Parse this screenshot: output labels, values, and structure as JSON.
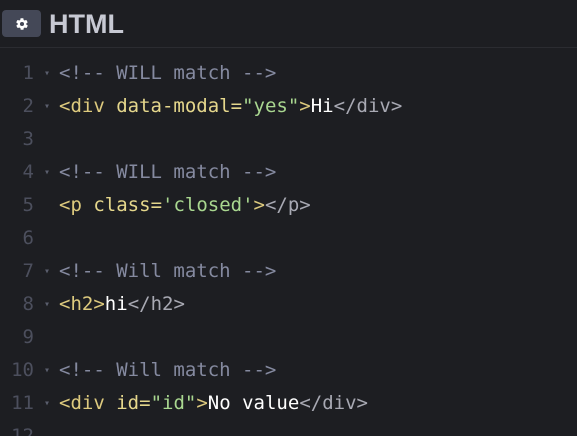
{
  "header": {
    "title": "HTML",
    "settings_icon": "gear-icon"
  },
  "lines": [
    {
      "num": "1",
      "fold": true,
      "tokens": [
        [
          "comment",
          "<!-- WILL match -->"
        ]
      ]
    },
    {
      "num": "2",
      "fold": true,
      "tokens": [
        [
          "bracket",
          "<"
        ],
        [
          "tag",
          "div"
        ],
        [
          "text",
          " "
        ],
        [
          "attr",
          "data-modal"
        ],
        [
          "eq",
          "="
        ],
        [
          "str",
          "\"yes\""
        ],
        [
          "bracket",
          ">"
        ],
        [
          "text",
          "Hi"
        ],
        [
          "dim",
          "</div>"
        ]
      ]
    },
    {
      "num": "3",
      "fold": false,
      "tokens": []
    },
    {
      "num": "4",
      "fold": true,
      "tokens": [
        [
          "comment",
          "<!-- WILL match -->"
        ]
      ]
    },
    {
      "num": "5",
      "fold": false,
      "tokens": [
        [
          "bracket",
          "<"
        ],
        [
          "tag",
          "p"
        ],
        [
          "text",
          " "
        ],
        [
          "attr",
          "class"
        ],
        [
          "eq",
          "="
        ],
        [
          "str",
          "'closed'"
        ],
        [
          "bracket",
          ">"
        ],
        [
          "dim",
          "</p>"
        ]
      ]
    },
    {
      "num": "6",
      "fold": false,
      "tokens": []
    },
    {
      "num": "7",
      "fold": true,
      "tokens": [
        [
          "comment",
          "<!-- Will match -->"
        ]
      ]
    },
    {
      "num": "8",
      "fold": true,
      "tokens": [
        [
          "bracket",
          "<"
        ],
        [
          "tag",
          "h2"
        ],
        [
          "bracket",
          ">"
        ],
        [
          "text",
          "hi"
        ],
        [
          "dim",
          "</h2>"
        ]
      ]
    },
    {
      "num": "9",
      "fold": false,
      "tokens": []
    },
    {
      "num": "10",
      "fold": true,
      "tokens": [
        [
          "comment",
          "<!-- Will match -->"
        ]
      ]
    },
    {
      "num": "11",
      "fold": true,
      "tokens": [
        [
          "bracket",
          "<"
        ],
        [
          "tag",
          "div"
        ],
        [
          "text",
          " "
        ],
        [
          "attr",
          "id"
        ],
        [
          "eq",
          "="
        ],
        [
          "str",
          "\"id\""
        ],
        [
          "bracket",
          ">"
        ],
        [
          "text",
          "No value"
        ],
        [
          "dim",
          "</div>"
        ]
      ]
    },
    {
      "num": "12",
      "fold": false,
      "tokens": []
    }
  ],
  "colors": {
    "background": "#1d1e22",
    "button": "#444857",
    "title": "#c7c9d3",
    "line_number": "#4c4f5d",
    "comment": "#858aa0",
    "tag": "#ddca7e",
    "string": "#a9d790",
    "text": "#ffffff"
  }
}
